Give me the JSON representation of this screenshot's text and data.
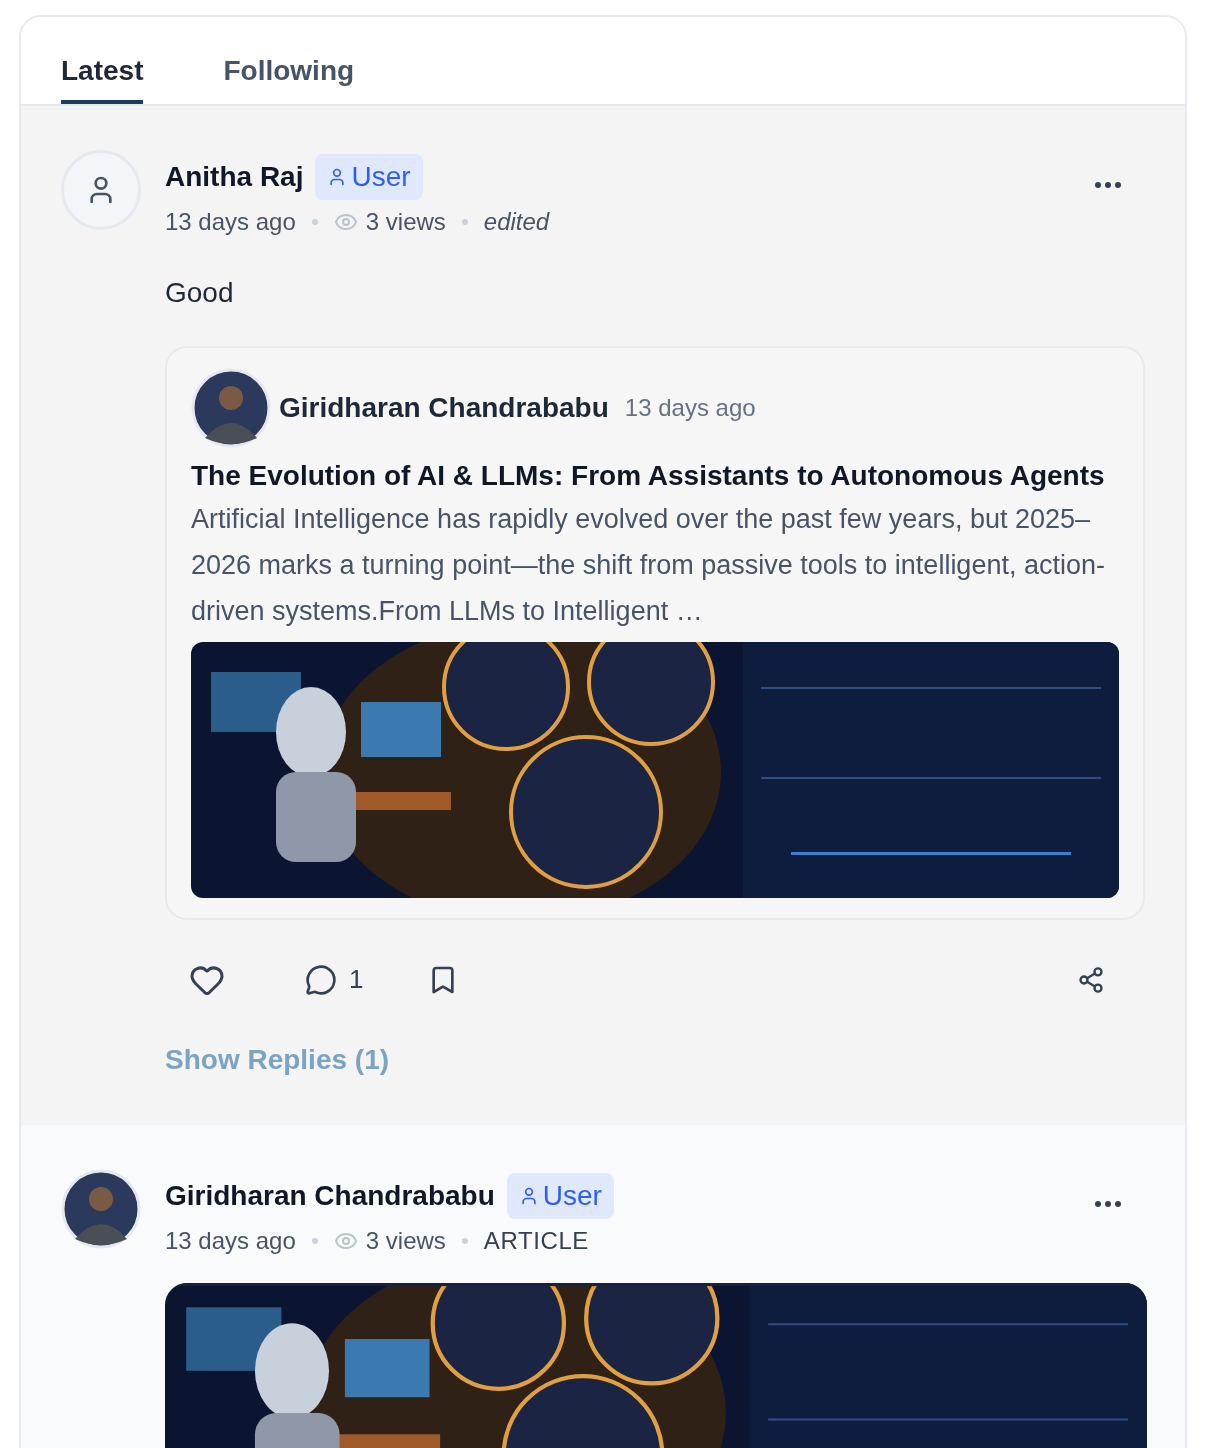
{
  "tabs": [
    {
      "label": "Latest",
      "selected": true
    },
    {
      "label": "Following",
      "selected": false
    }
  ],
  "posts": [
    {
      "avatar": {
        "kind": "placeholder"
      },
      "author": "Anitha Raj",
      "badge": "User",
      "time": "13 days ago",
      "views": "3 views",
      "note": {
        "kind": "edited",
        "text": "edited"
      },
      "body": "Good",
      "quote": {
        "author": "Giridharan Chandrababu",
        "time": "13 days ago",
        "title": "The Evolution of AI & LLMs: From Assistants to Autonomous Agents",
        "excerpt": "Artificial Intelligence has rapidly evolved over the past few years, but 2025–2026 marks a turning point—the shift from passive tools to intelligent, action-driven systems.From LLMs to Intelligent …"
      },
      "comments": "1",
      "replies_link": "Show Replies (1)"
    },
    {
      "author": "Giridharan Chandrababu",
      "badge": "User",
      "time": "13 days ago",
      "views": "3 views",
      "note": {
        "kind": "category",
        "text": "ARTICLE"
      }
    }
  ]
}
